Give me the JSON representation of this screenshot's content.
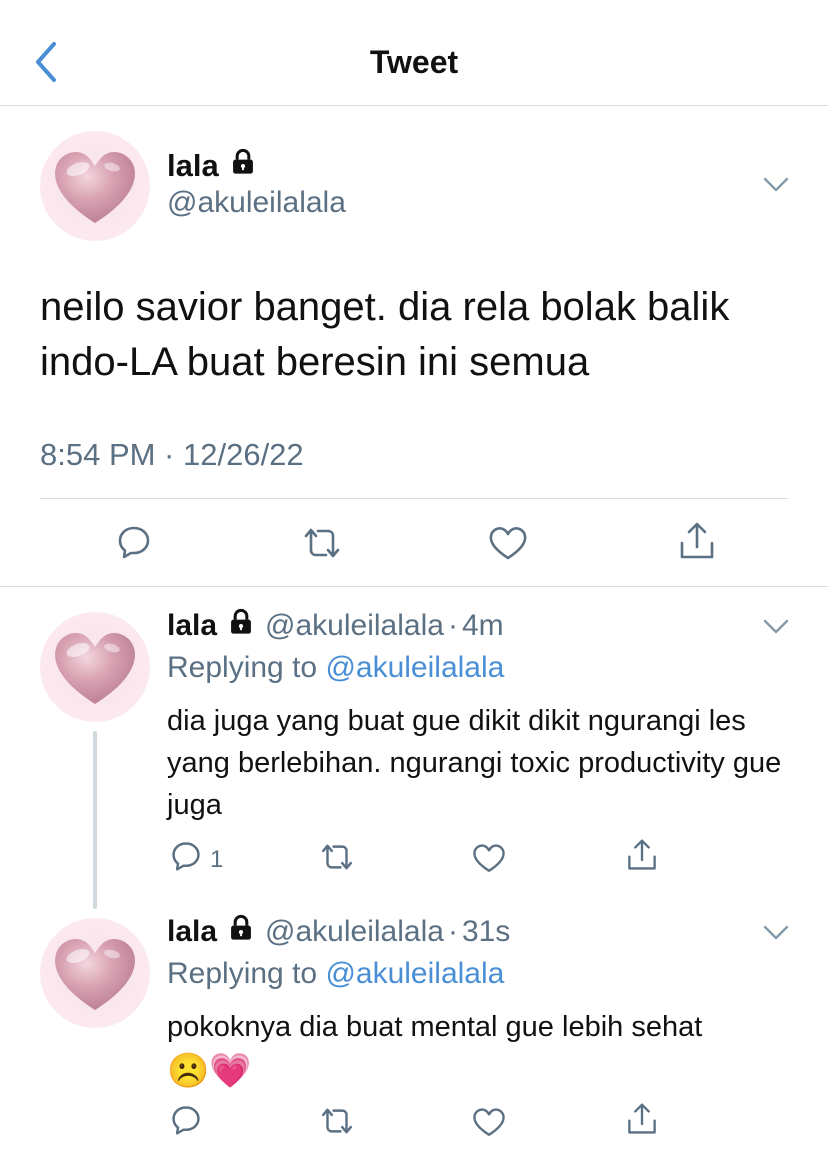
{
  "header": {
    "title": "Tweet",
    "back_icon": "chevron-left-icon"
  },
  "colors": {
    "accent": "#4a8fd6",
    "muted": "#5b7083",
    "divider": "#dcdcdc",
    "avatar_heart": "#d9a3b3"
  },
  "main_tweet": {
    "author_name": "lala",
    "handle": "@akuleilalala",
    "text": "neilo savior banget. dia rela bolak balik indo-LA buat beresin ini semua",
    "timestamp": "8:54 PM · 12/26/22"
  },
  "replies": [
    {
      "author_name": "lala",
      "handle": "@akuleilalala",
      "separator": "·",
      "time": "4m",
      "replying_label": "Replying to",
      "replying_to": "@akuleilalala",
      "text": "dia juga yang buat gue dikit dikit ngurangi les yang berlebihan. ngurangi toxic productivity gue juga",
      "reply_count": "1"
    },
    {
      "author_name": "lala",
      "handle": "@akuleilalala",
      "separator": "·",
      "time": "31s",
      "replying_label": "Replying to",
      "replying_to": "@akuleilalala",
      "text": "pokoknya dia buat mental gue lebih sehat",
      "emojis": "☹️💗",
      "reply_count": ""
    }
  ]
}
